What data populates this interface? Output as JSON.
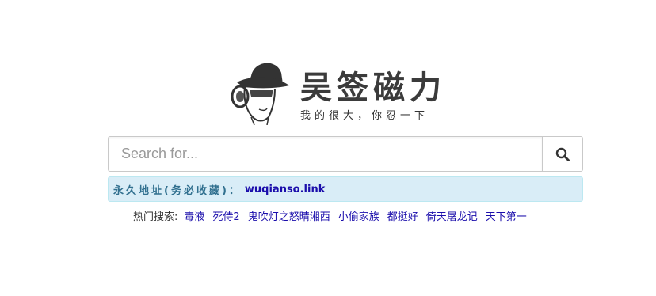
{
  "logo": {
    "title": "吴签磁力",
    "slogan": "我的很大，你忍一下"
  },
  "search": {
    "placeholder": "Search for...",
    "value": "",
    "button_icon": "search-icon"
  },
  "notice": {
    "label": "永久地址(务必收藏)：",
    "link": "wuqianso.link"
  },
  "hot": {
    "label": "热门搜索:",
    "items": [
      "毒液",
      "死侍2",
      "鬼吹灯之怒晴湘西",
      "小偷家族",
      "都挺好",
      "倚天屠龙记",
      "天下第一"
    ]
  },
  "colors": {
    "notice_bg": "#d9edf7",
    "notice_text": "#31708f",
    "link": "#1a0dab"
  }
}
